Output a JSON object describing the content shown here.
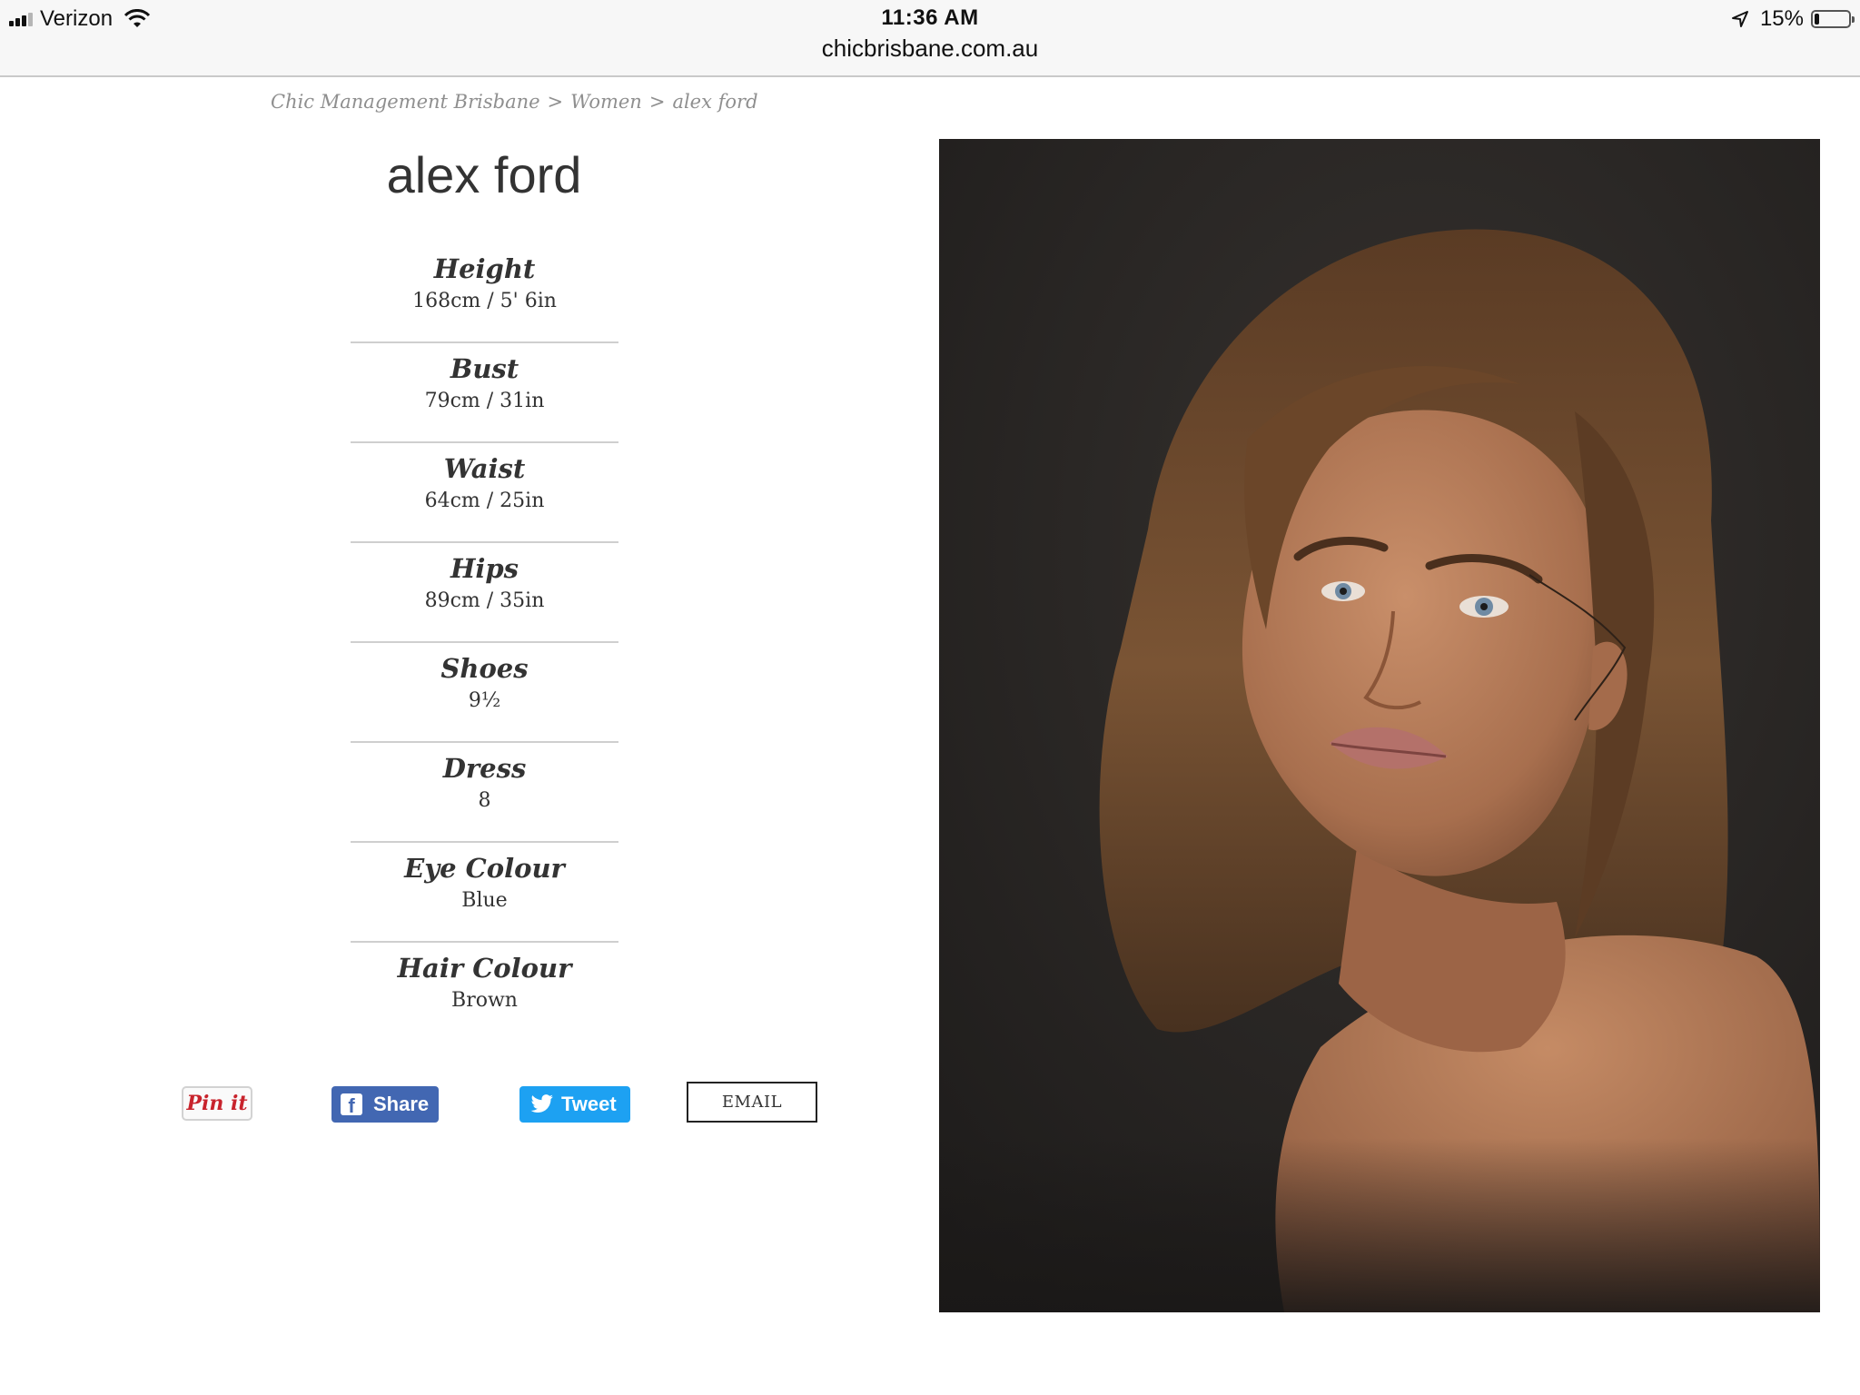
{
  "status_bar": {
    "carrier": "Verizon",
    "time": "11:36 AM",
    "url": "chicbrisbane.com.au",
    "battery_percent_label": "15%",
    "battery_level": 0.15
  },
  "breadcrumb": {
    "items": [
      "Chic Management Brisbane",
      "Women",
      "alex ford"
    ],
    "separator": ">"
  },
  "model": {
    "name": "alex ford"
  },
  "stats": [
    {
      "label": "Height",
      "value": "168cm / 5' 6in"
    },
    {
      "label": "Bust",
      "value": "79cm / 31in"
    },
    {
      "label": "Waist",
      "value": "64cm / 25in"
    },
    {
      "label": "Hips",
      "value": "89cm / 35in"
    },
    {
      "label": "Shoes",
      "value": "9½"
    },
    {
      "label": "Dress",
      "value": "8"
    },
    {
      "label": "Eye Colour",
      "value": "Blue"
    },
    {
      "label": "Hair Colour",
      "value": "Brown"
    }
  ],
  "share": {
    "pinterest_label": "Pin it",
    "facebook_label": "Share",
    "twitter_label": "Tweet",
    "email_label": "EMAIL"
  },
  "colors": {
    "facebook": "#4267b2",
    "twitter": "#1da1f2",
    "pinterest": "#c8232c"
  }
}
